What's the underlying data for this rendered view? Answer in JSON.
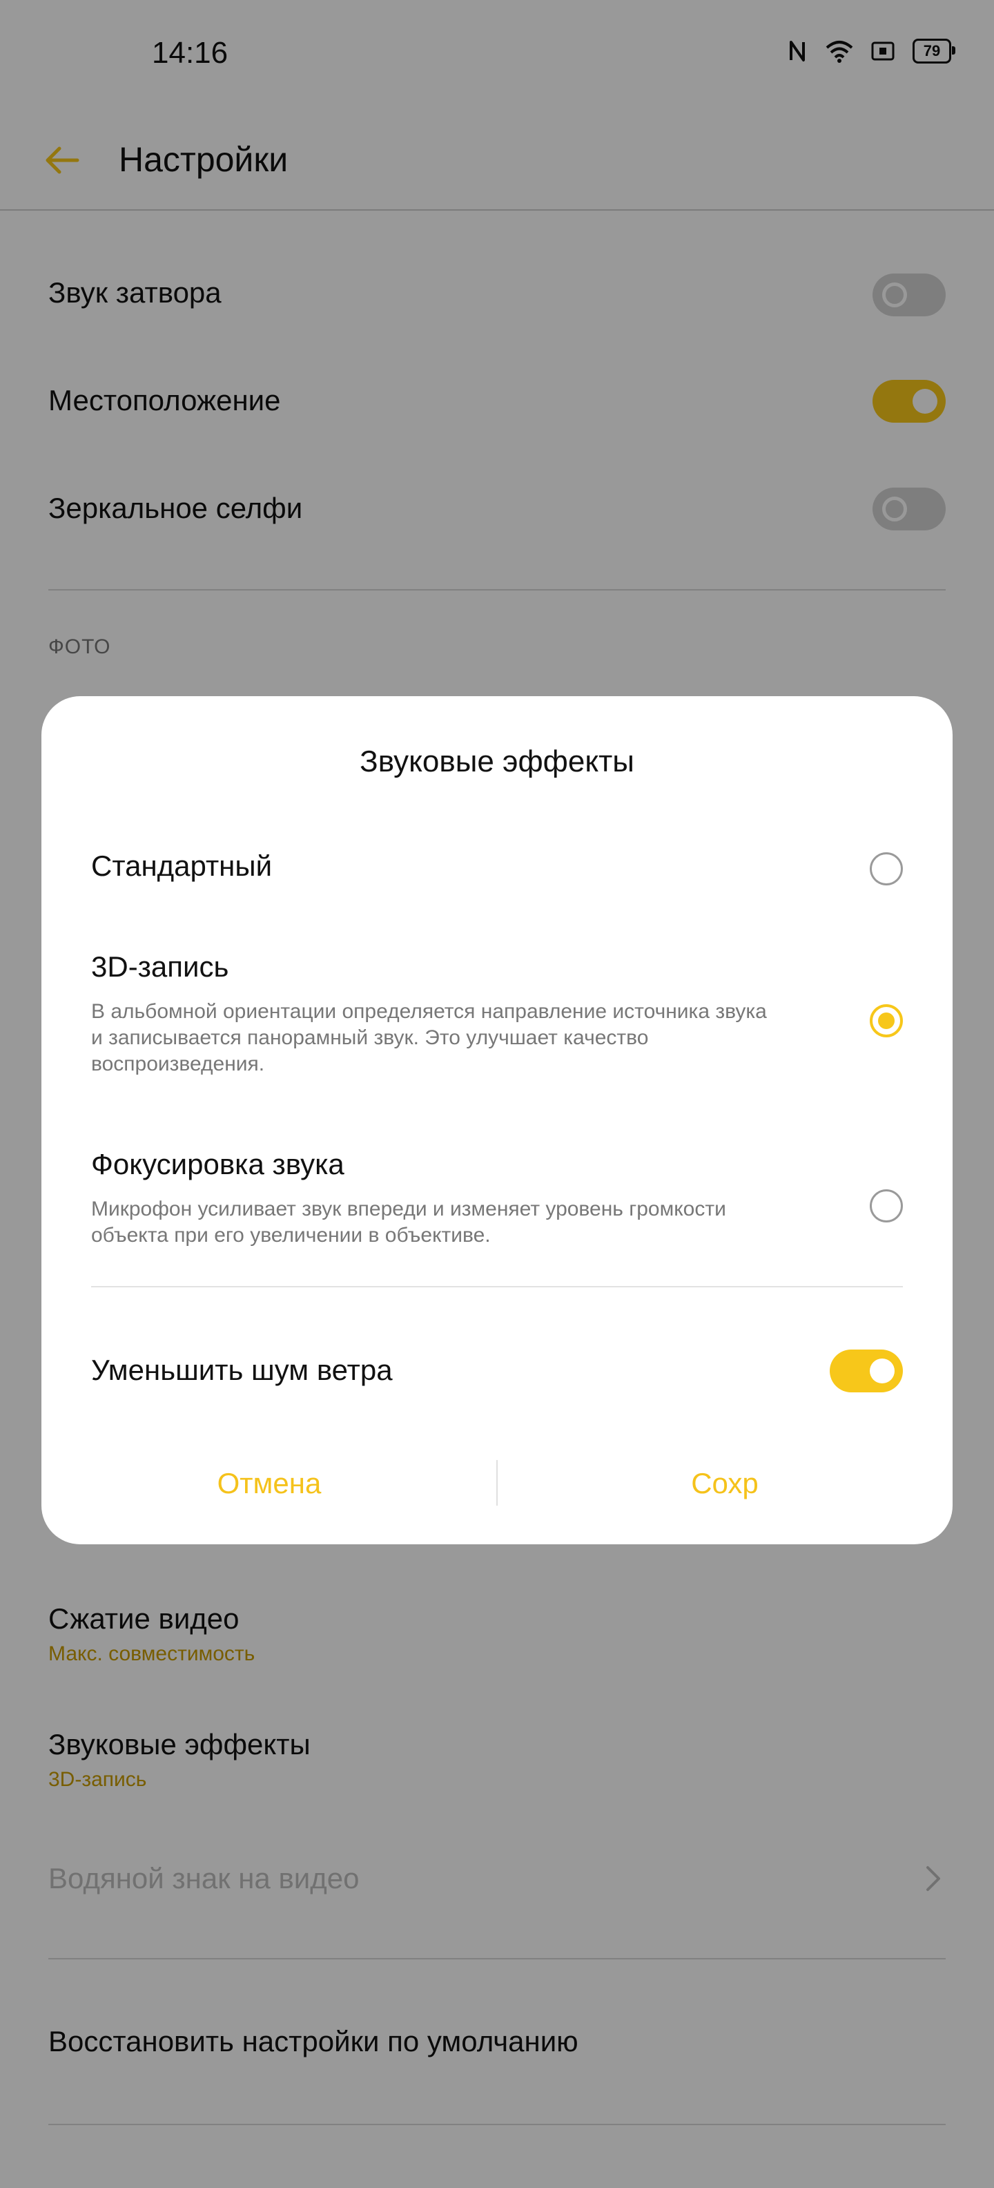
{
  "status_bar": {
    "time": "14:16",
    "battery": "79",
    "icons": [
      "nfc-icon",
      "wifi-icon",
      "sim-icon",
      "battery-icon"
    ]
  },
  "app_bar": {
    "title": "Настройки",
    "back_icon": "arrow-left-icon"
  },
  "settings": {
    "shutter_sound": {
      "label": "Звук затвора",
      "enabled": false
    },
    "location": {
      "label": "Местоположение",
      "enabled": true
    },
    "mirror_selfie": {
      "label": "Зеркальное селфи",
      "enabled": false
    },
    "photo_section_header": "ФОТО",
    "video_compression": {
      "label": "Сжатие видео",
      "value": "Макс. совместимость"
    },
    "sound_effects": {
      "label": "Звуковые эффекты",
      "value": "3D-запись"
    },
    "video_watermark": {
      "label": "Водяной знак на видео"
    },
    "reset_defaults": {
      "label": "Восстановить настройки по умолчанию"
    }
  },
  "dialog": {
    "title": "Звуковые эффекты",
    "options": [
      {
        "title": "Стандартный",
        "description": "",
        "selected": false
      },
      {
        "title": "3D-запись",
        "description": "В альбомной ориентации определяется направление источника звука и записывается панорамный звук. Это улучшает качество воспроизведения.",
        "selected": true
      },
      {
        "title": "Фокусировка звука",
        "description": "Микрофон усиливает звук впереди и изменяет уровень громкости объекта при его увеличении в объективе.",
        "selected": false
      }
    ],
    "wind_noise": {
      "label": "Уменьшить шум ветра",
      "enabled": true
    },
    "cancel_label": "Отмена",
    "save_label": "Сохр"
  },
  "colors": {
    "accent": "#f7c71a",
    "accent_text": "#c89b00",
    "scrim": "rgba(0,0,0,0.40)"
  }
}
